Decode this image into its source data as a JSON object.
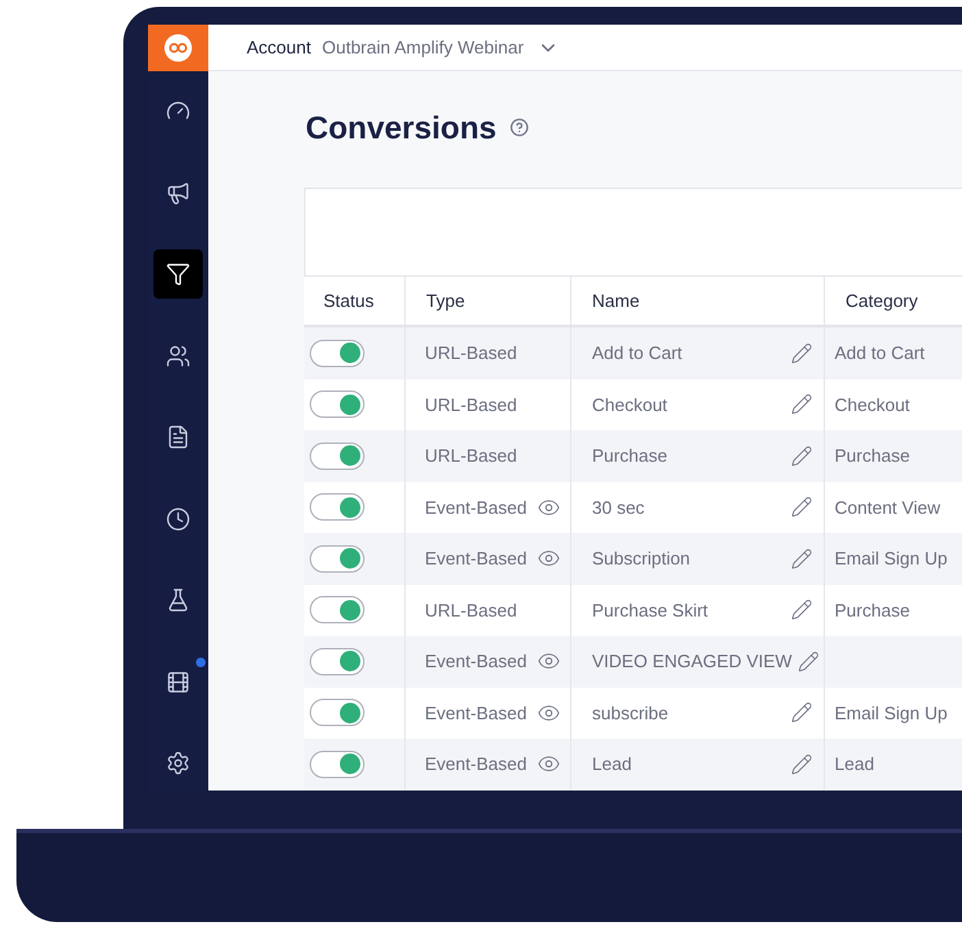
{
  "account": {
    "label": "Account",
    "value": "Outbrain Amplify Webinar"
  },
  "sidebar": {
    "items": [
      {
        "kind": "dashboard",
        "selected": false,
        "notification": false
      },
      {
        "kind": "campaigns",
        "selected": false,
        "notification": false
      },
      {
        "kind": "conversions",
        "selected": true,
        "notification": false
      },
      {
        "kind": "audiences",
        "selected": false,
        "notification": false
      },
      {
        "kind": "reports",
        "selected": false,
        "notification": false
      },
      {
        "kind": "history",
        "selected": false,
        "notification": false
      },
      {
        "kind": "lab",
        "selected": false,
        "notification": false
      },
      {
        "kind": "video",
        "selected": false,
        "notification": true
      },
      {
        "kind": "settings",
        "selected": false,
        "notification": false
      }
    ]
  },
  "page": {
    "title": "Conversions"
  },
  "table": {
    "columns": [
      "Status",
      "Type",
      "Name",
      "Category"
    ],
    "rows": [
      {
        "on": true,
        "kind": "url",
        "type": "URL-Based",
        "name": "Add to Cart",
        "category": "Add to Cart"
      },
      {
        "on": true,
        "kind": "url",
        "type": "URL-Based",
        "name": "Checkout",
        "category": "Checkout"
      },
      {
        "on": true,
        "kind": "url",
        "type": "URL-Based",
        "name": "Purchase",
        "category": "Purchase"
      },
      {
        "on": true,
        "kind": "event",
        "type": "Event-Based",
        "name": "30 sec",
        "category": "Content View"
      },
      {
        "on": true,
        "kind": "event",
        "type": "Event-Based",
        "name": "Subscription",
        "category": "Email Sign Up"
      },
      {
        "on": true,
        "kind": "url",
        "type": "URL-Based",
        "name": "Purchase Skirt",
        "category": "Purchase"
      },
      {
        "on": true,
        "kind": "event",
        "type": "Event-Based",
        "name": "VIDEO ENGAGED VIEW"
      },
      {
        "on": true,
        "kind": "event",
        "type": "Event-Based",
        "name": "subscribe",
        "category": "Email Sign Up"
      },
      {
        "on": true,
        "kind": "event",
        "type": "Event-Based",
        "name": "Lead",
        "category": "Lead"
      }
    ]
  }
}
